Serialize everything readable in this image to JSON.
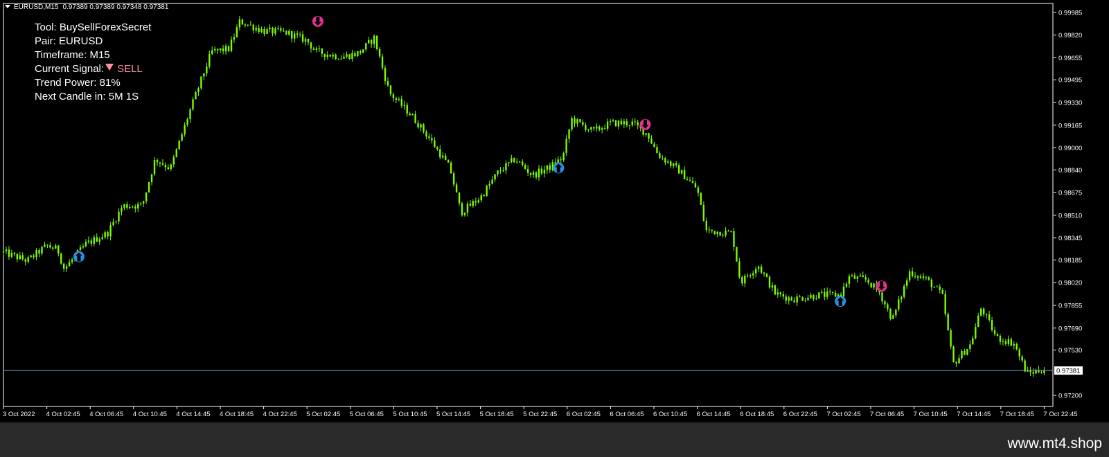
{
  "header": {
    "symbol_tf": "EURUSD,M15",
    "ohlc": "0.97389 0.97389 0.97348 0.97381"
  },
  "info_panel": {
    "tool": "Tool: BuySellForexSecret",
    "pair": "Pair: EURUSD",
    "timeframe": "Timeframe: M15",
    "current_signal_label": "Current Signal:",
    "current_signal_value": "SELL",
    "trend_power": "Trend Power: 81%",
    "next_candle": "Next Candle in: 5M 1S"
  },
  "watermark": "www.mt4.shop",
  "colors": {
    "background": "#000000",
    "candle": "#7CFC00",
    "buy_arrow": "#2b8fe0",
    "sell_arrow": "#e0328f",
    "price_line": "#7f9fbf",
    "sell_text": "#ff8ca0",
    "axis": "#ffffff"
  },
  "chart_data": {
    "type": "candlestick",
    "symbol": "EURUSD",
    "timeframe": "M15",
    "y_ticks": [
      0.99985,
      0.9982,
      0.99655,
      0.99495,
      0.9933,
      0.99165,
      0.99,
      0.9884,
      0.98675,
      0.9851,
      0.98345,
      0.98185,
      0.9802,
      0.97855,
      0.9769,
      0.9753,
      0.972
    ],
    "ylim": [
      0.9712,
      1.0005
    ],
    "current_price": "0.97381",
    "x_ticks": [
      "3 Oct 2022",
      "4 Oct 02:45",
      "4 Oct 06:45",
      "4 Oct 10:45",
      "4 Oct 14:45",
      "4 Oct 18:45",
      "4 Oct 22:45",
      "5 Oct 02:45",
      "5 Oct 06:45",
      "5 Oct 10:45",
      "5 Oct 14:45",
      "5 Oct 18:45",
      "5 Oct 22:45",
      "6 Oct 02:45",
      "6 Oct 06:45",
      "6 Oct 10:45",
      "6 Oct 14:45",
      "6 Oct 18:45",
      "6 Oct 22:45",
      "7 Oct 02:45",
      "7 Oct 06:45",
      "7 Oct 10:45",
      "7 Oct 14:45",
      "7 Oct 18:45",
      "7 Oct 22:45"
    ],
    "price_path": [
      {
        "t": 0,
        "p": 0.9824
      },
      {
        "t": 0.55,
        "p": 0.9818
      },
      {
        "t": 1.0,
        "p": 0.9829
      },
      {
        "t": 1.25,
        "p": 0.9826
      },
      {
        "t": 1.4,
        "p": 0.9812
      },
      {
        "t": 1.9,
        "p": 0.983
      },
      {
        "t": 2.4,
        "p": 0.9838
      },
      {
        "t": 2.75,
        "p": 0.9858
      },
      {
        "t": 3.2,
        "p": 0.9858
      },
      {
        "t": 3.5,
        "p": 0.9892
      },
      {
        "t": 3.85,
        "p": 0.9885
      },
      {
        "t": 4.3,
        "p": 0.9927
      },
      {
        "t": 4.8,
        "p": 0.997
      },
      {
        "t": 5.2,
        "p": 0.9972
      },
      {
        "t": 5.45,
        "p": 0.9992
      },
      {
        "t": 6.0,
        "p": 0.9985
      },
      {
        "t": 6.5,
        "p": 0.9984
      },
      {
        "t": 7.0,
        "p": 0.9978
      },
      {
        "t": 7.2,
        "p": 0.997
      },
      {
        "t": 7.8,
        "p": 0.9966
      },
      {
        "t": 8.2,
        "p": 0.9969
      },
      {
        "t": 8.55,
        "p": 0.998
      },
      {
        "t": 8.9,
        "p": 0.994
      },
      {
        "t": 9.4,
        "p": 0.9924
      },
      {
        "t": 9.8,
        "p": 0.9908
      },
      {
        "t": 10.3,
        "p": 0.9885
      },
      {
        "t": 10.55,
        "p": 0.9853
      },
      {
        "t": 11.0,
        "p": 0.9864
      },
      {
        "t": 11.4,
        "p": 0.9882
      },
      {
        "t": 11.8,
        "p": 0.9892
      },
      {
        "t": 12.2,
        "p": 0.988
      },
      {
        "t": 12.6,
        "p": 0.9886
      },
      {
        "t": 12.9,
        "p": 0.9893
      },
      {
        "t": 13.1,
        "p": 0.9921
      },
      {
        "t": 13.6,
        "p": 0.9912
      },
      {
        "t": 14.0,
        "p": 0.9918
      },
      {
        "t": 14.5,
        "p": 0.9918
      },
      {
        "t": 14.85,
        "p": 0.991
      },
      {
        "t": 15.1,
        "p": 0.9895
      },
      {
        "t": 15.6,
        "p": 0.9883
      },
      {
        "t": 16.0,
        "p": 0.987
      },
      {
        "t": 16.2,
        "p": 0.984
      },
      {
        "t": 16.8,
        "p": 0.9838
      },
      {
        "t": 17.0,
        "p": 0.9802
      },
      {
        "t": 17.4,
        "p": 0.9815
      },
      {
        "t": 17.8,
        "p": 0.9794
      },
      {
        "t": 18.2,
        "p": 0.979
      },
      {
        "t": 18.8,
        "p": 0.9793
      },
      {
        "t": 19.3,
        "p": 0.9793
      },
      {
        "t": 19.5,
        "p": 0.9806
      },
      {
        "t": 19.9,
        "p": 0.9804
      },
      {
        "t": 20.2,
        "p": 0.9795
      },
      {
        "t": 20.5,
        "p": 0.9775
      },
      {
        "t": 20.9,
        "p": 0.981
      },
      {
        "t": 21.3,
        "p": 0.9804
      },
      {
        "t": 21.65,
        "p": 0.9793
      },
      {
        "t": 21.9,
        "p": 0.9743
      },
      {
        "t": 22.3,
        "p": 0.9757
      },
      {
        "t": 22.55,
        "p": 0.9784
      },
      {
        "t": 22.9,
        "p": 0.9762
      },
      {
        "t": 23.3,
        "p": 0.9758
      },
      {
        "t": 23.6,
        "p": 0.9736
      },
      {
        "t": 24.0,
        "p": 0.9739
      }
    ],
    "signals": [
      {
        "type": "buy",
        "t": 1.74,
        "p": 0.9821
      },
      {
        "type": "sell",
        "t": 7.25,
        "p": 0.9992
      },
      {
        "type": "buy",
        "t": 12.8,
        "p": 0.98855
      },
      {
        "type": "sell",
        "t": 14.8,
        "p": 0.9917
      },
      {
        "type": "buy",
        "t": 19.3,
        "p": 0.97885
      },
      {
        "type": "sell",
        "t": 20.25,
        "p": 0.97995
      }
    ]
  }
}
